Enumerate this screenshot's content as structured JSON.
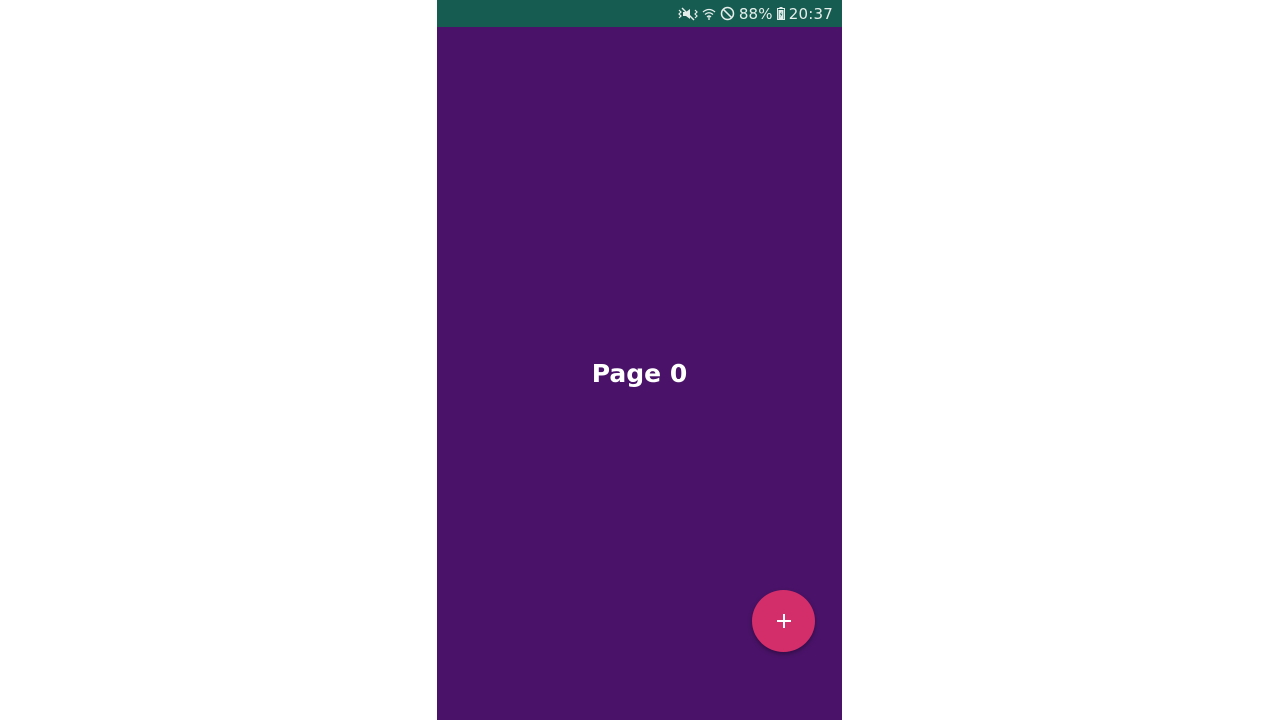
{
  "status_bar": {
    "battery_percent": "88%",
    "time": "20:37",
    "icons": [
      "mute-vibrate-icon",
      "wifi-icon",
      "do-not-disturb-icon",
      "battery-icon"
    ]
  },
  "main": {
    "page_title": "Page 0"
  },
  "fab": {
    "icon": "plus-icon",
    "color": "#d32d6a"
  },
  "colors": {
    "status_bar_bg": "#165c50",
    "page_bg": "#4a1369",
    "fab_bg": "#d32d6a"
  }
}
